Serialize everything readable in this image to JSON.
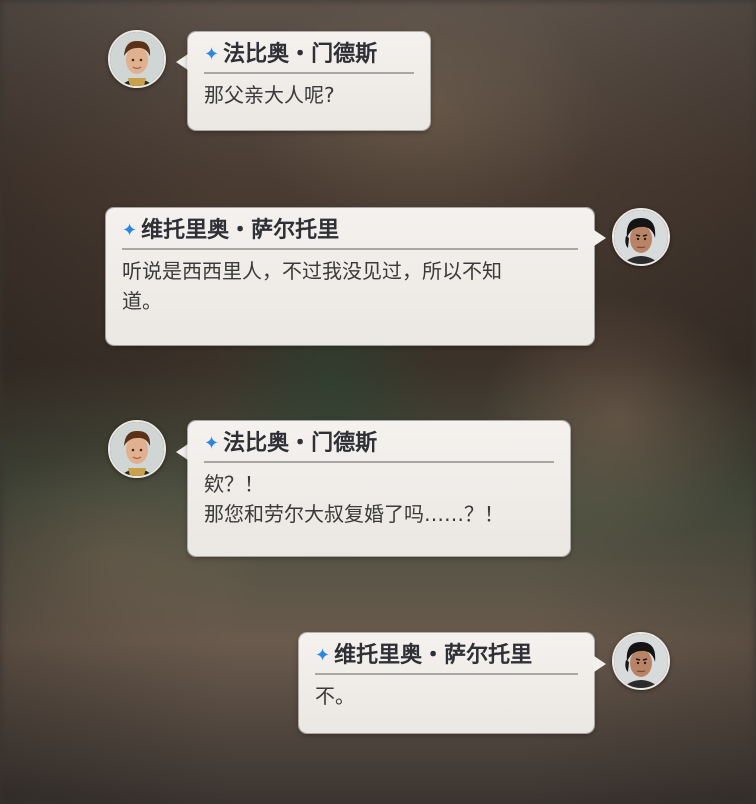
{
  "messages": [
    {
      "speaker": "法比奥・门德斯",
      "lines": [
        "那父亲大人呢?"
      ]
    },
    {
      "speaker": "维托里奥・萨尔托里",
      "lines": [
        "听说是西西里人，不过我没见过，所以不知",
        "道。"
      ]
    },
    {
      "speaker": "法比奥・门德斯",
      "lines": [
        "欸？！",
        "那您和劳尔大叔复婚了吗……？！"
      ]
    },
    {
      "speaker": "维托里奥・萨尔托里",
      "lines": [
        "不。"
      ]
    }
  ],
  "icons": {
    "speaker_marker": "sparkle-star-icon",
    "avatar_fabio": "fabio-portrait",
    "avatar_vittorio": "vittorio-portrait"
  },
  "colors": {
    "bubble_bg": "#f2efec",
    "name_text": "#2f2f36",
    "body_text": "#3a3a3a",
    "star_accent": "#2a86e0",
    "divider": "#a9a6a3"
  }
}
